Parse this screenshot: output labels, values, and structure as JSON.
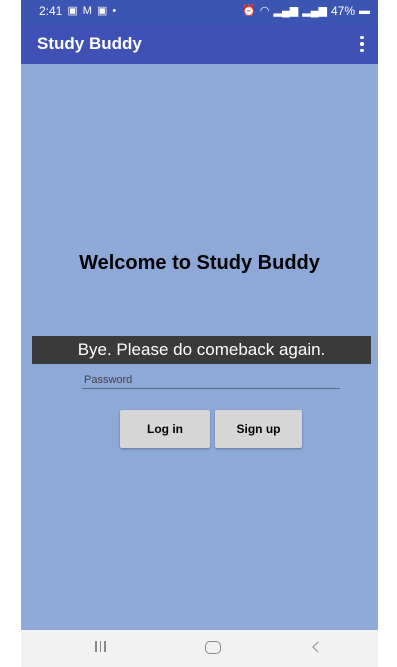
{
  "status_bar": {
    "time": "2:41",
    "left_icons": [
      "gallery-icon",
      "gmail-icon",
      "message-icon",
      "dot-icon"
    ],
    "right_icons": [
      "alarm-icon",
      "wifi-icon",
      "signal-icon",
      "volte-icon",
      "signal-icon",
      "battery-icon"
    ],
    "battery": "47%"
  },
  "app_bar": {
    "title": "Study Buddy",
    "overflow_icon": "more-vert-icon"
  },
  "main": {
    "welcome": "Welcome to Study Buddy",
    "toast": "Bye. Please do comeback again.",
    "password_placeholder": "Password",
    "login_label": "Log in",
    "signup_label": "Sign up"
  },
  "nav_bar": {
    "icons": [
      "recents-icon",
      "home-icon",
      "back-icon"
    ]
  },
  "colors": {
    "app_bar": "#3f51b5",
    "background": "#8ea8d8",
    "toast": "#3a3a3a",
    "button": "#d6d6d6"
  }
}
